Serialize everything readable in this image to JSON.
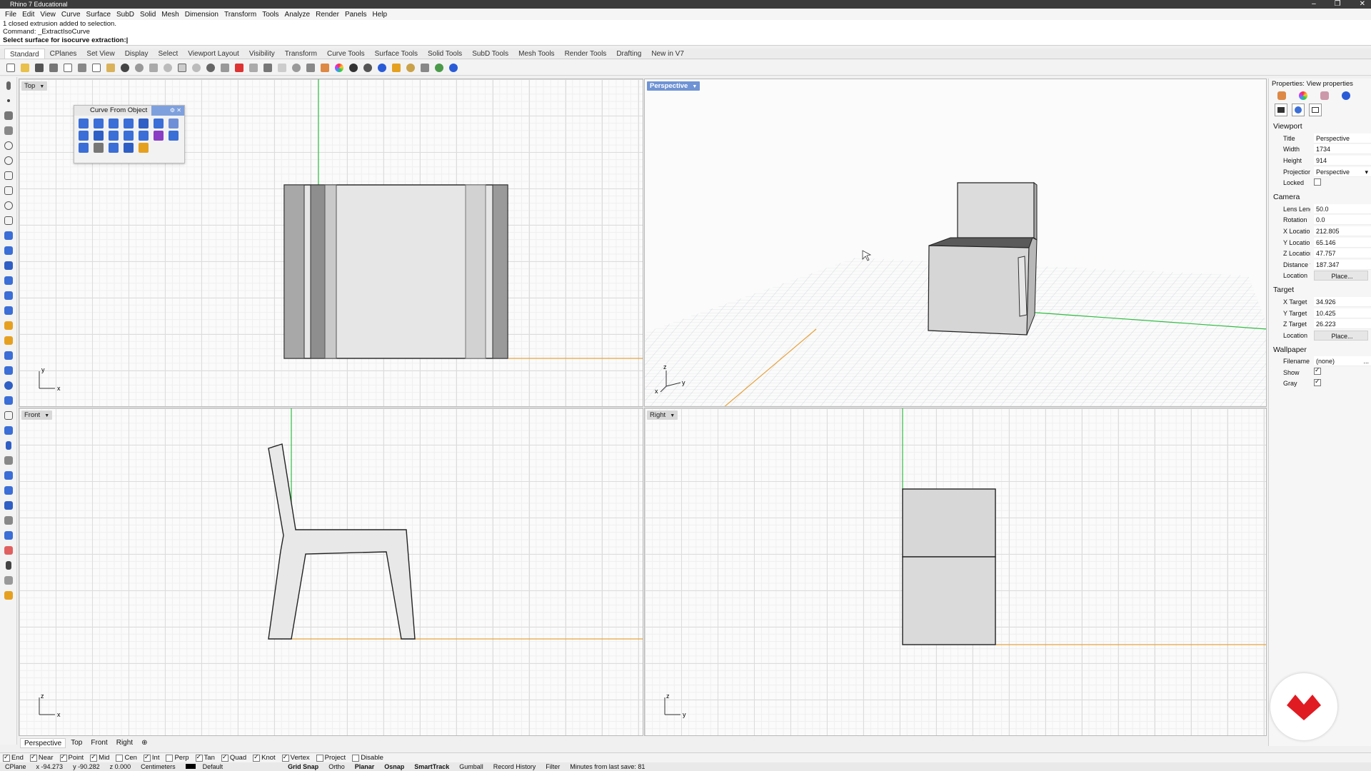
{
  "window": {
    "title": "Rhino 7 Educational",
    "controls": [
      "–",
      "❐",
      "✕"
    ]
  },
  "menu": [
    "File",
    "Edit",
    "View",
    "Curve",
    "Surface",
    "SubD",
    "Solid",
    "Mesh",
    "Dimension",
    "Transform",
    "Tools",
    "Analyze",
    "Render",
    "Panels",
    "Help"
  ],
  "command_history": [
    "1 closed extrusion added to selection.",
    "Command: _ExtractIsoCurve"
  ],
  "command_prompt": "Select surface for isocurve extraction:",
  "toolbar_tabs": [
    "Standard",
    "CPlanes",
    "Set View",
    "Display",
    "Select",
    "Viewport Layout",
    "Visibility",
    "Transform",
    "Curve Tools",
    "Surface Tools",
    "Solid Tools",
    "SubD Tools",
    "Mesh Tools",
    "Render Tools",
    "Drafting",
    "New in V7"
  ],
  "viewports": {
    "top": {
      "label": "Top"
    },
    "perspective": {
      "label": "Perspective"
    },
    "front": {
      "label": "Front"
    },
    "right": {
      "label": "Right"
    }
  },
  "axes": {
    "x": "x",
    "y": "y",
    "z": "z"
  },
  "floating_panel": {
    "title": "Curve From Object"
  },
  "properties": {
    "title": "Properties: View properties",
    "viewport_section": "Viewport",
    "viewport": [
      {
        "k": "Title",
        "v": "Perspective"
      },
      {
        "k": "Width",
        "v": "1734"
      },
      {
        "k": "Height",
        "v": "914"
      },
      {
        "k": "Projection",
        "v": "Perspective"
      }
    ],
    "locked_label": "Locked",
    "camera_section": "Camera",
    "camera": [
      {
        "k": "Lens Lengt...",
        "v": "50.0"
      },
      {
        "k": "Rotation",
        "v": "0.0"
      },
      {
        "k": "X Location",
        "v": "212.805"
      },
      {
        "k": "Y Location",
        "v": "65.146"
      },
      {
        "k": "Z Location",
        "v": "47.757"
      },
      {
        "k": "Distance to...",
        "v": "187.347"
      }
    ],
    "location_label": "Location",
    "place_button": "Place...",
    "target_section": "Target",
    "target": [
      {
        "k": "X Target",
        "v": "34.926"
      },
      {
        "k": "Y Target",
        "v": "10.425"
      },
      {
        "k": "Z Target",
        "v": "26.223"
      }
    ],
    "wallpaper_section": "Wallpaper",
    "filename_label": "Filename",
    "filename_value": "(none)",
    "show_label": "Show",
    "gray_label": "Gray"
  },
  "viewport_tabs": [
    "Perspective",
    "Top",
    "Front",
    "Right"
  ],
  "osnaps": [
    {
      "label": "End",
      "on": true
    },
    {
      "label": "Near",
      "on": true
    },
    {
      "label": "Point",
      "on": true
    },
    {
      "label": "Mid",
      "on": true
    },
    {
      "label": "Cen",
      "on": false
    },
    {
      "label": "Int",
      "on": true
    },
    {
      "label": "Perp",
      "on": false
    },
    {
      "label": "Tan",
      "on": true
    },
    {
      "label": "Quad",
      "on": true
    },
    {
      "label": "Knot",
      "on": true
    },
    {
      "label": "Vertex",
      "on": true
    },
    {
      "label": "Project",
      "on": false
    },
    {
      "label": "Disable",
      "on": false
    }
  ],
  "status": {
    "cplane": "CPlane",
    "x": "x -94.273",
    "y": "y -90.282",
    "z": "z 0.000",
    "units": "Centimeters",
    "layer": "Default",
    "grid_snap": "Grid Snap",
    "ortho": "Ortho",
    "planar": "Planar",
    "osnap": "Osnap",
    "smarttrack": "SmartTrack",
    "gumball": "Gumball",
    "record_history": "Record History",
    "filter": "Filter",
    "save_info": "Minutes from last save: 81"
  },
  "colors": {
    "accent": "#6f93d4",
    "x_axis": "#e8a33d",
    "y_axis": "#2ebd3f",
    "logo": "#e11b22"
  }
}
